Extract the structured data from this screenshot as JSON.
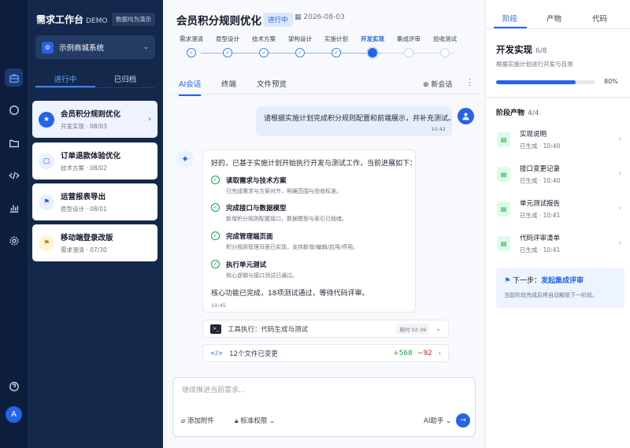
{
  "app": {
    "title": "需求工作台",
    "subtitle": "DEMO",
    "demo_badge": "数据均为演示",
    "project": "示例商城系统"
  },
  "rail": {
    "avatar": "A",
    "icons": [
      "briefcase-icon",
      "chat-icon",
      "folder-icon",
      "code-icon",
      "chart-icon",
      "gear-icon",
      "help-icon"
    ]
  },
  "sidebar": {
    "tabs": [
      "进行中",
      "已归档"
    ],
    "tasks": [
      {
        "name": "会员积分规则优化",
        "meta": "开发实现 · 08/03",
        "icon": "★",
        "active": true
      },
      {
        "name": "订单退款体验优化",
        "meta": "技术方案 · 08/02",
        "icon": "▢",
        "active": false
      },
      {
        "name": "运营报表导出",
        "meta": "原型设计 · 08/01",
        "icon": "⚑",
        "active": false
      },
      {
        "name": "移动端登录改版",
        "meta": "需求澄清 · 07/30",
        "icon": "⚑",
        "active": false
      }
    ]
  },
  "header": {
    "title": "会员积分规则优化",
    "status": "进行中",
    "date": "2026-08-03"
  },
  "stages": [
    {
      "label": "需求澄清",
      "state": "done"
    },
    {
      "label": "原型设计",
      "state": "done"
    },
    {
      "label": "技术方案",
      "state": "done"
    },
    {
      "label": "架构设计",
      "state": "done"
    },
    {
      "label": "实施计划",
      "state": "done"
    },
    {
      "label": "开发实现",
      "state": "current"
    },
    {
      "label": "集成评审",
      "state": "todo"
    },
    {
      "label": "验收测试",
      "state": "todo"
    }
  ],
  "content_tabs": {
    "tabs": [
      "AI会话",
      "终端",
      "文件预览"
    ],
    "new_chat": "新会话"
  },
  "chat": {
    "user_message": "请根据实施计划完成积分规则配置和前端展示，并补充测试。",
    "user_time": "10:42",
    "ai_intro": "好的，已基于实施计划开始执行开发与测试工作，当前进展如下：",
    "steps": [
      {
        "title": "读取需求与技术方案",
        "desc": "已完成需求与方案对齐，明确范围与验收标准。"
      },
      {
        "title": "完成接口与数据模型",
        "desc": "新增积分规则配置接口，数据模型与索引已就绪。"
      },
      {
        "title": "完成管理端页面",
        "desc": "积分规则管理页面已实现，支持新增/编辑/启用/停用。"
      },
      {
        "title": "执行单元测试",
        "desc": "核心逻辑与接口测试已通过。"
      }
    ],
    "ai_summary": "核心功能已完成，18项测试通过，等待代码评审。",
    "ai_time": "10:45",
    "tool_label": "工具执行：代码生成与测试",
    "tool_duration": "耗时 02:36",
    "files_label": "12个文件已变更",
    "files_added": "+568",
    "files_removed": "−92"
  },
  "composer": {
    "placeholder": "继续推进当前需求...",
    "attach": "添加附件",
    "permission": "标准权限",
    "assistant": "AI助手"
  },
  "right": {
    "tabs": [
      "阶段",
      "产物",
      "代码"
    ],
    "phase_title": "开发实现",
    "phase_count": "6/8",
    "phase_desc": "根据实施计划进行开发与自测",
    "progress": 0.8,
    "progress_label": "80%",
    "artifacts_title": "阶段产物",
    "artifacts_count": "4/4",
    "artifacts": [
      {
        "name": "实现说明",
        "meta": "已生成 · 10:40"
      },
      {
        "name": "接口变更记录",
        "meta": "已生成 · 10:40"
      },
      {
        "name": "单元测试报告",
        "meta": "已生成 · 10:41"
      },
      {
        "name": "代码评审清单",
        "meta": "已生成 · 10:41"
      }
    ],
    "next_prefix": "下一步：",
    "next_action": "发起集成评审",
    "next_desc": "当前阶段完成后将自动解锁下一阶段。"
  },
  "colors": {
    "accent": "#2563eb",
    "sidebar_bg": "#14284c",
    "rail_bg": "#0d1e3d",
    "success": "#16a34a",
    "danger": "#dc2626"
  }
}
